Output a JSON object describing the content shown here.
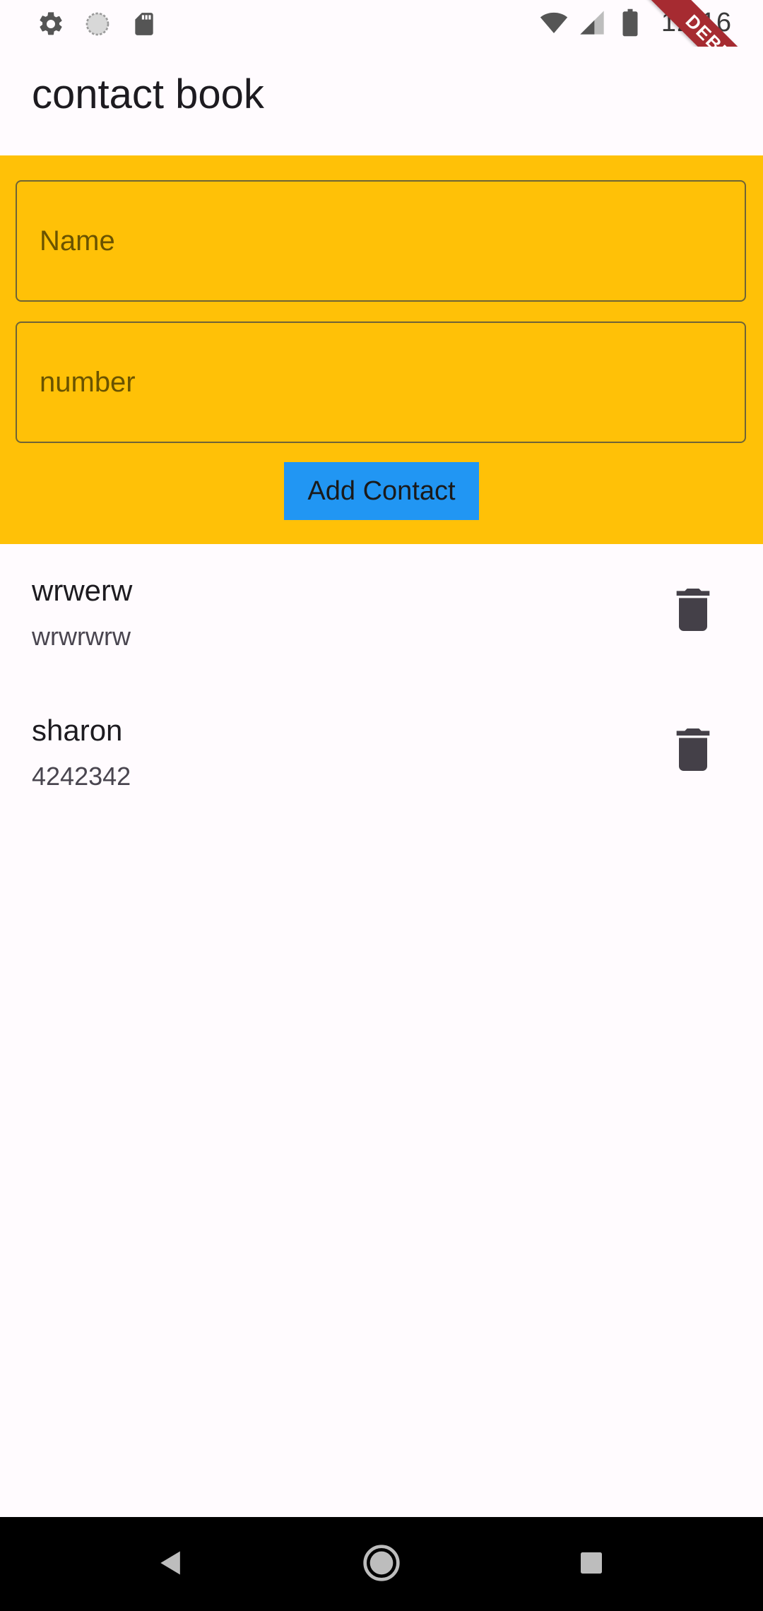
{
  "status_bar": {
    "time": "12:16",
    "left_icons": [
      "settings-icon",
      "loading-icon",
      "sd-card-icon"
    ],
    "right_icons": [
      "wifi-icon",
      "cell-signal-icon",
      "battery-icon"
    ]
  },
  "debug_banner": "DEBUG",
  "app_bar": {
    "title": "contact book"
  },
  "form": {
    "name_placeholder": "Name",
    "number_placeholder": "number",
    "name_value": "",
    "number_value": "",
    "add_button_label": "Add Contact",
    "background_color": "#ffc107",
    "button_color": "#2196f3"
  },
  "contacts": [
    {
      "name": "wrwerw",
      "number": "wrwrwrw"
    },
    {
      "name": "sharon",
      "number": "4242342"
    }
  ],
  "nav_bar": {
    "buttons": [
      "back-icon",
      "home-icon",
      "recents-icon"
    ]
  }
}
